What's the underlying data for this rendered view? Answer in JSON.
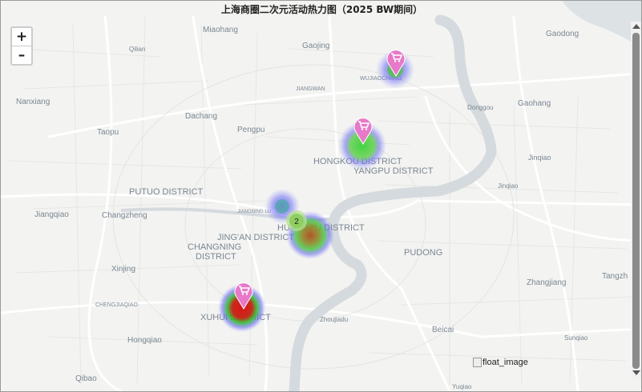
{
  "title": "上海商圈二次元活动热力图（2025 BW期间）",
  "zoom": {
    "in_label": "+",
    "out_label": "–"
  },
  "float_image_alt": "float_image",
  "cluster_count": "2",
  "colors": {
    "water": "#d4dadd",
    "land": "#f3f3f2",
    "road": "#ffffff",
    "marker": "#e879c8",
    "heat_low": "#5a5af0",
    "heat_mid": "#54c84a",
    "heat_high": "#d21e1e",
    "cluster": "#9ad56a"
  },
  "places": {
    "miaohang": "Miaohang",
    "gaojing": "Gaojing",
    "gaodong": "Gaodong",
    "qilian": "Qilian",
    "wujiaochang": "WUJIAOCHANG",
    "nanxiang": "Nanxiang",
    "jiangwan": "JIANGWAN",
    "donggou": "Donggou",
    "gaohang": "Gaohang",
    "dachang": "Dachang",
    "taopu": "Taopu",
    "pengpu": "Pengpu",
    "hongkou": "HONGKOU DISTRICT",
    "yangpu": "YANGPU DISTRICT",
    "jinqiao": "Jinqiao",
    "putuo": "PUTUO DISTRICT",
    "jinqiao2": "Jinqiao",
    "jiangqiao": "Jiangqiao",
    "changzheng": "Changzheng",
    "jiangning": "JIANGNING LU",
    "huangpu": "HUANGPU DISTRICT",
    "jingan": "JING'AN DISTRICT",
    "changning1": "CHANGNING",
    "changning2": "DISTRICT",
    "pudong": "PUDONG",
    "xinjing": "Xinjing",
    "zhangjiang": "Zhangjiang",
    "tangzhen": "Tangzh",
    "chengjiaqiao": "CHENGJIAQIAO",
    "xuhui": "XUHUI DISTRICT",
    "zhoujiadu": "Zhoujiadu",
    "hongqiao": "Hongqiao",
    "beicai": "Beicai",
    "sunqiao": "Sunqiao",
    "qibao": "Qibao",
    "yuqiao": "Yuqiao"
  }
}
